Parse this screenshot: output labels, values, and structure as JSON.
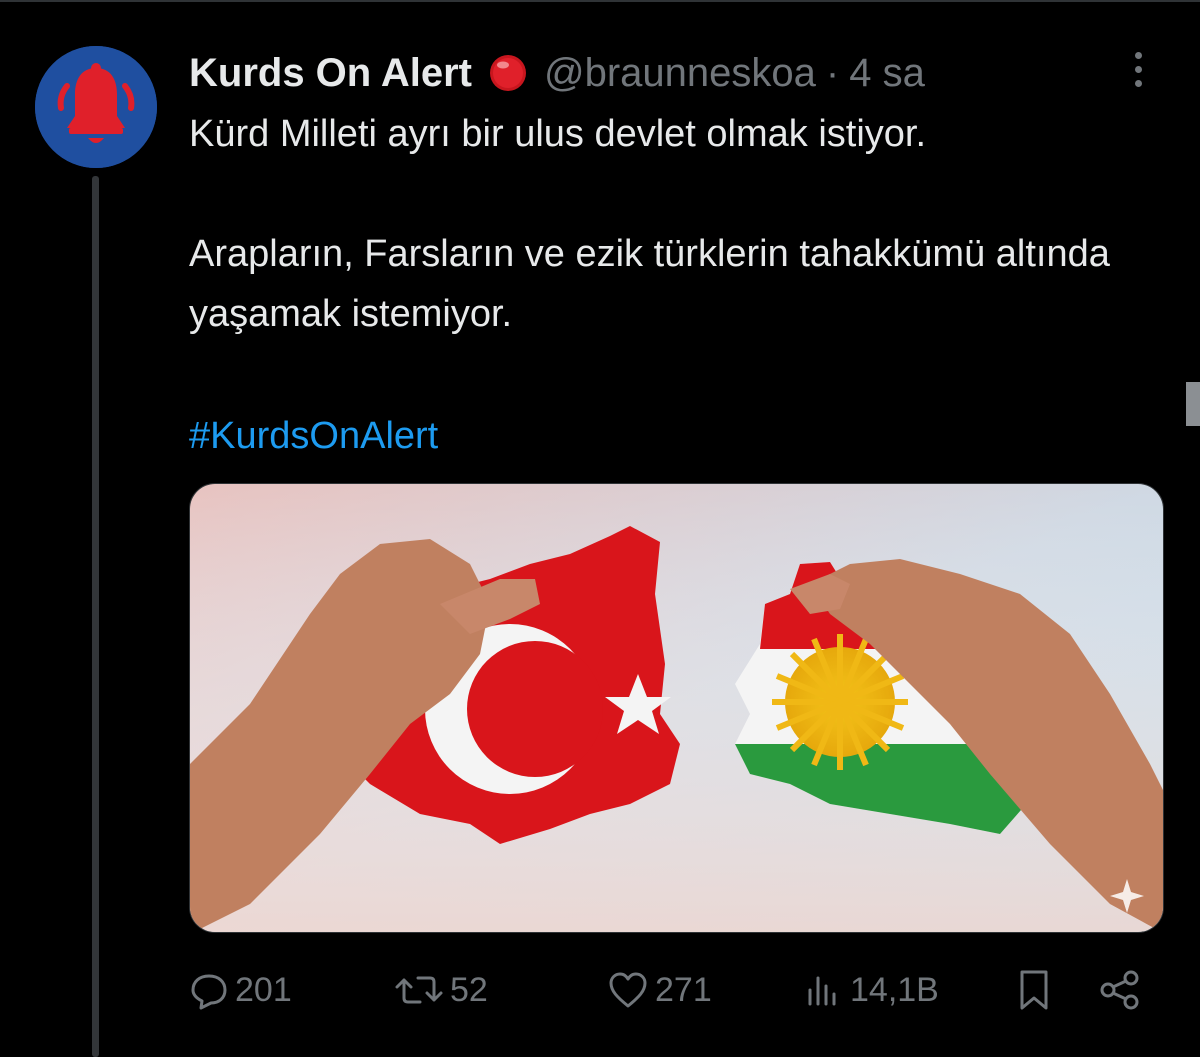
{
  "tweet": {
    "display_name": "Kurds On Alert",
    "handle": "@braunneskoa",
    "separator": "·",
    "time": "4 sa",
    "paragraphs": [
      "Kürd Milleti ayrı bir ulus devlet olmak istiyor.",
      "Arapların, Farsların ve ezik türklerin tahakkümü altında yaşamak istemiyor."
    ],
    "hashtag": "#KurdsOnAlert",
    "badge_color": "#e0202a",
    "avatar_bg": "#1f4fa0",
    "avatar_icon": "bell-icon"
  },
  "media": {
    "description_icons": [
      "turkey-flag-shape",
      "kurdistan-flag-shape"
    ]
  },
  "actions": {
    "replies": "201",
    "retweets": "52",
    "likes": "271",
    "views": "14,1B"
  },
  "colors": {
    "background": "#000000",
    "text": "#e7e9ea",
    "muted": "#71767b",
    "link": "#1d9bf0"
  }
}
